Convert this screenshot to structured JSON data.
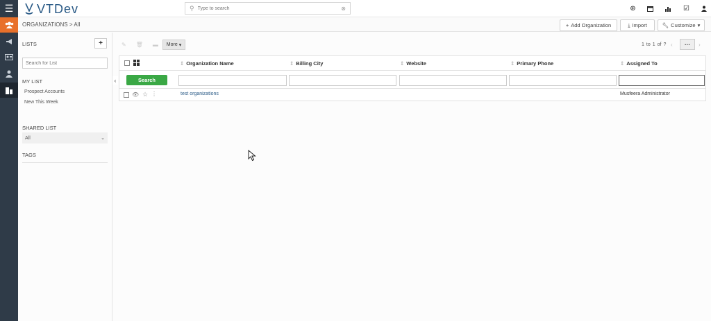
{
  "app": {
    "name": "VTDev"
  },
  "search": {
    "placeholder": "Type to search"
  },
  "rail_icons": [
    "menu-icon",
    "organizations-icon",
    "campaigns-icon",
    "contacts-card-icon",
    "person-icon",
    "building-icon"
  ],
  "breadcrumb": {
    "module": "ORGANIZATIONS",
    "sep": ">",
    "view": "All"
  },
  "toolbar": {
    "add_label": "Add Organization",
    "import_label": "Import",
    "customize_label": "Customize",
    "more_label": "More"
  },
  "sidebar": {
    "lists_title": "LISTS",
    "search_placeholder": "Search for List",
    "my_list_title": "MY LIST",
    "my_list_items": [
      "Prospect Accounts",
      "New This Week"
    ],
    "shared_title": "SHARED LIST",
    "shared_selected": "All",
    "tags_title": "TAGS"
  },
  "pagination": {
    "from": "1",
    "to_word": "to",
    "to": "1",
    "of_word": "of",
    "total": "?"
  },
  "table": {
    "columns": [
      "Organization Name",
      "Billing City",
      "Website",
      "Primary Phone",
      "Assigned To"
    ],
    "search_label": "Search",
    "rows": [
      {
        "name": "test organizations",
        "city": "",
        "website": "",
        "phone": "",
        "assigned": "Musfeera Administrator"
      }
    ]
  }
}
